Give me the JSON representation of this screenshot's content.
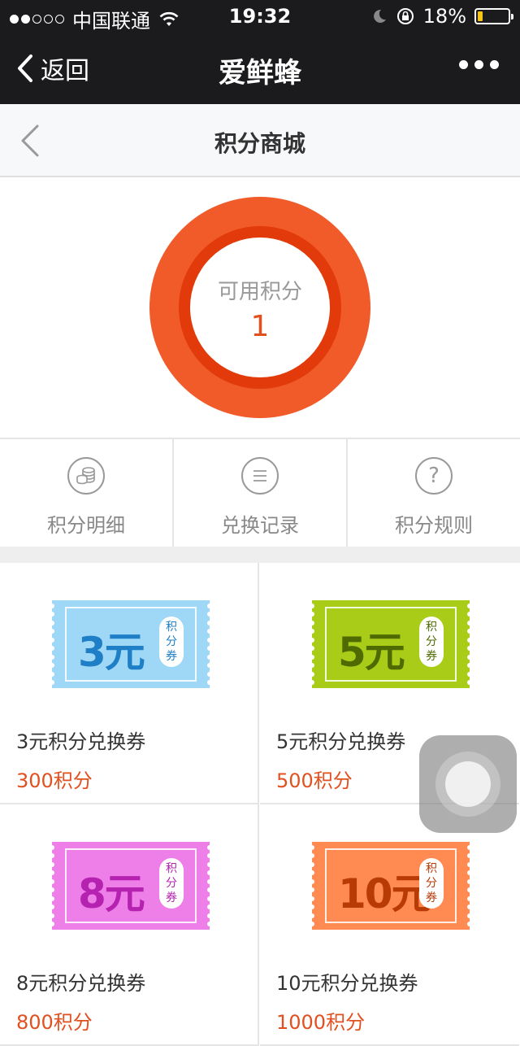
{
  "status_bar": {
    "carrier": "中国联通",
    "time": "19:32",
    "battery": "18%",
    "battery_level": 0.18
  },
  "nav": {
    "back_label": "返回",
    "title": "爱鲜蜂"
  },
  "page": {
    "title": "积分商城"
  },
  "points": {
    "label": "可用积分",
    "value": "1"
  },
  "menu": [
    {
      "label": "积分明细",
      "icon": "coins-icon"
    },
    {
      "label": "兑换记录",
      "icon": "list-icon"
    },
    {
      "label": "积分规则",
      "icon": "question-icon"
    }
  ],
  "products": [
    {
      "amount": "3元",
      "badge": [
        "积",
        "分",
        "券"
      ],
      "name": "3元积分兑换券",
      "price": "300积分",
      "bg": "#9fd8f7",
      "fg": "#1e7fc6"
    },
    {
      "amount": "5元",
      "badge": [
        "积",
        "分",
        "券"
      ],
      "name": "5元积分兑换券",
      "price": "500积分",
      "bg": "#a8cc18",
      "fg": "#4f6a00"
    },
    {
      "amount": "8元",
      "badge": [
        "积",
        "分",
        "券"
      ],
      "name": "8元积分兑换券",
      "price": "800积分",
      "bg": "#ee7ee8",
      "fg": "#b522b0"
    },
    {
      "amount": "10元",
      "badge": [
        "积",
        "分",
        "券"
      ],
      "name": "10元积分兑换券",
      "price": "1000积分",
      "bg": "#ff8a52",
      "fg": "#b83a05"
    }
  ]
}
